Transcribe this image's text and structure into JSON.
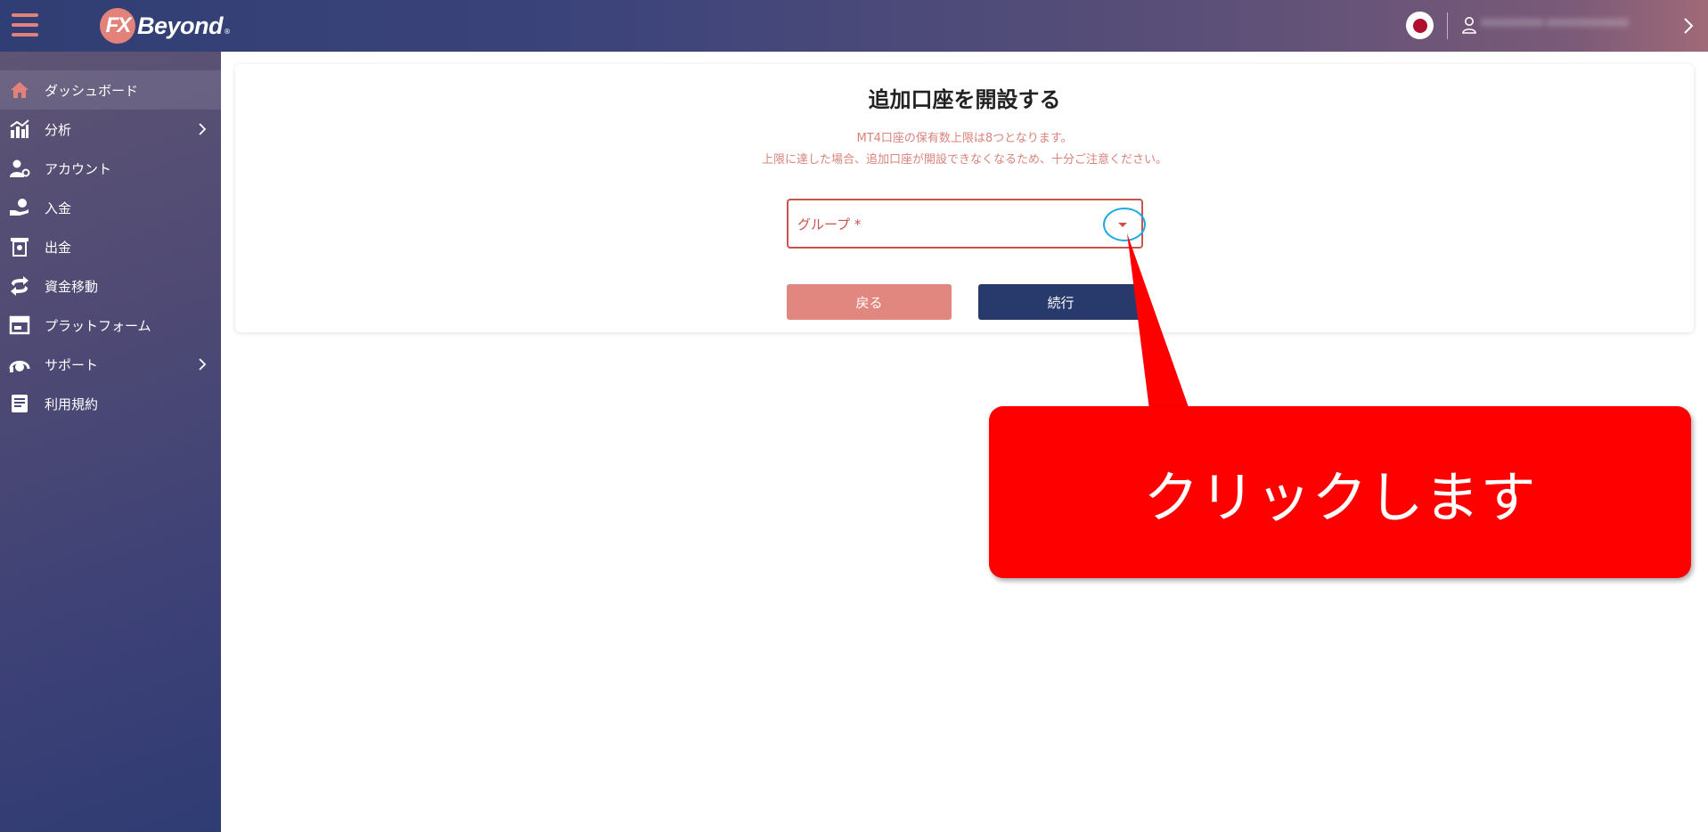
{
  "header": {
    "logo_mark": "FX",
    "logo_text": "Beyond",
    "logo_reg": "®",
    "user_name": "xxxxxxxxx-xxxxxxxxxxxx"
  },
  "sidebar": {
    "items": [
      {
        "label": "ダッシュボード",
        "icon": "home-icon",
        "active": true,
        "has_submenu": false
      },
      {
        "label": "分析",
        "icon": "chart-icon",
        "active": false,
        "has_submenu": true
      },
      {
        "label": "アカウント",
        "icon": "user-settings-icon",
        "active": false,
        "has_submenu": false
      },
      {
        "label": "入金",
        "icon": "deposit-icon",
        "active": false,
        "has_submenu": false
      },
      {
        "label": "出金",
        "icon": "withdraw-icon",
        "active": false,
        "has_submenu": false
      },
      {
        "label": "資金移動",
        "icon": "transfer-icon",
        "active": false,
        "has_submenu": false
      },
      {
        "label": "プラットフォーム",
        "icon": "platform-icon",
        "active": false,
        "has_submenu": false
      },
      {
        "label": "サポート",
        "icon": "support-icon",
        "active": false,
        "has_submenu": true
      },
      {
        "label": "利用規約",
        "icon": "terms-icon",
        "active": false,
        "has_submenu": false
      }
    ]
  },
  "main": {
    "title": "追加口座を開設する",
    "notice_line1": "MT4口座の保有数上限は8つとなります。",
    "notice_line2": "上限に達した場合、追加口座が開設できなくなるため、十分ご注意ください。",
    "group_select": {
      "label": "グループ *",
      "value": ""
    },
    "back_label": "戻る",
    "continue_label": "続行"
  },
  "annotation": {
    "callout_text": "クリックします"
  },
  "colors": {
    "accent": "#e2827a",
    "navy": "#283a6c",
    "error": "#c9534d",
    "callout": "#ff0000",
    "highlight": "#1aa9e2"
  }
}
